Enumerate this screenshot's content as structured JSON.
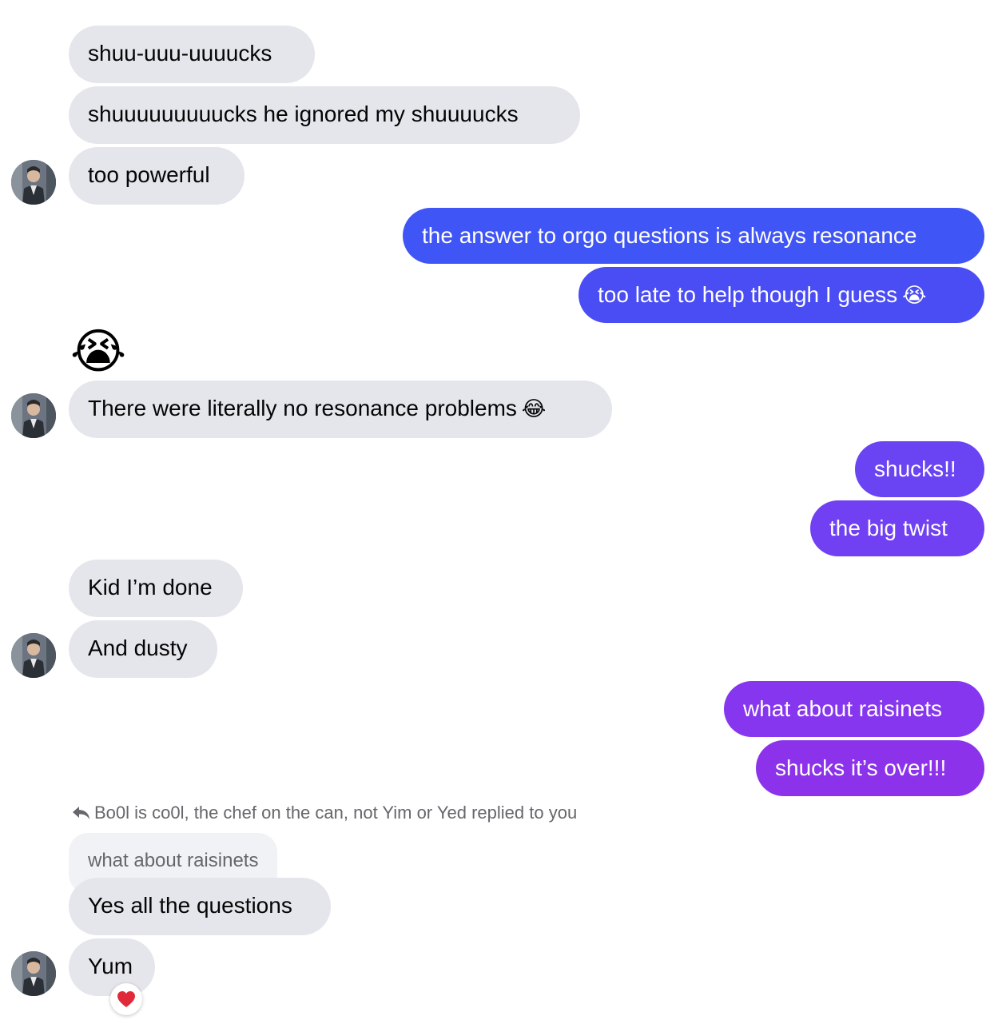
{
  "messages": {
    "m1": "shuu-uuu-uuuucks",
    "m2": "shuuuuuuuuucks he ignored my shuuuucks",
    "m3": "too powerful",
    "m4": "the answer to orgo questions is always resonance",
    "m5": "too late to help though I guess",
    "m5_emoji": "😭",
    "m6_emoji": "😭",
    "m7": "There were literally no resonance problems",
    "m7_emoji": "😂",
    "m8": "shucks!!",
    "m9": "the big twist",
    "m10": "Kid I’m done",
    "m11": "And dusty",
    "m12": "what about raisinets",
    "m13": "shucks it’s over!!!",
    "m14": "Yes all the questions",
    "m15": "Yum"
  },
  "reply": {
    "note": "Bo0l is co0l, the chef on the can, not Yim or Yed replied to you",
    "quote": "what about raisinets"
  },
  "reaction": "❤️",
  "colors": {
    "incoming": "#e4e6eb",
    "outgoing_blue": "#3b55f5",
    "outgoing_purple": "#8a34ee"
  }
}
